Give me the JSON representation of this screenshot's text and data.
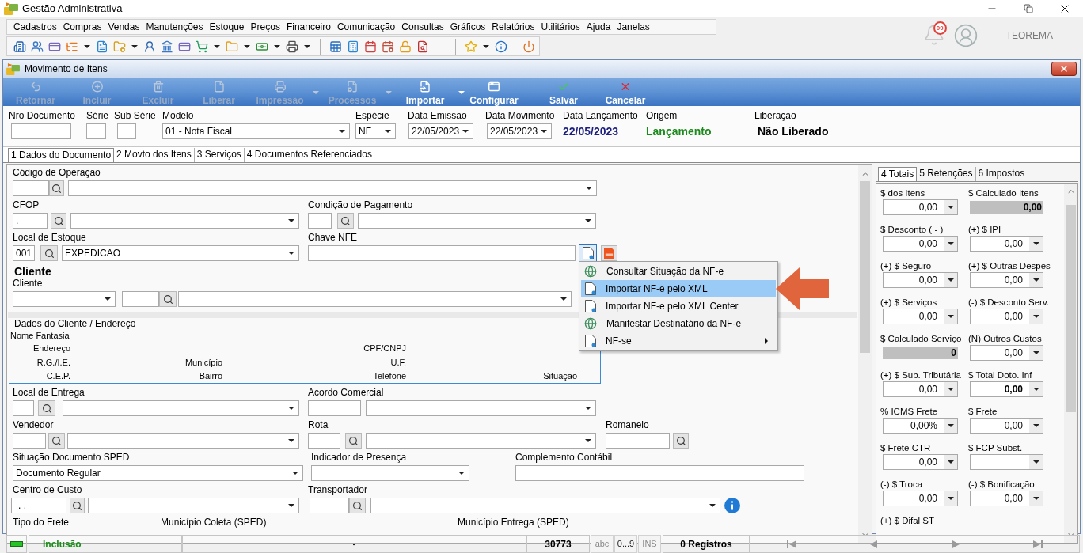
{
  "window": {
    "title": "Gestão Administrativa"
  },
  "menu_bar": [
    "Cadastros",
    "Compras",
    "Vendas",
    "Manutenções",
    "Estoque",
    "Preços",
    "Financeiro",
    "Comunicação",
    "Consultas",
    "Gráficos",
    "Relatórios",
    "Utilitários",
    "Ajuda",
    "Janelas"
  ],
  "notifications": {
    "count": "00"
  },
  "user": {
    "name": "TEOREMA"
  },
  "document_window": {
    "title": "Movimento de Itens"
  },
  "toolbar": [
    {
      "label": "Retornar",
      "disabled": true,
      "dropdown": false
    },
    {
      "label": "Incluir",
      "disabled": true,
      "dropdown": false
    },
    {
      "label": "Excluir",
      "disabled": true,
      "dropdown": false
    },
    {
      "label": "Liberar",
      "disabled": true,
      "dropdown": false
    },
    {
      "label": "Impressão",
      "disabled": true,
      "dropdown": true
    },
    {
      "label": "Processos",
      "disabled": true,
      "dropdown": true
    },
    {
      "label": "Importar",
      "disabled": false,
      "dropdown": true
    },
    {
      "label": "Configurar",
      "disabled": false,
      "dropdown": false
    },
    {
      "label": "Salvar",
      "disabled": false,
      "dropdown": false
    },
    {
      "label": "Cancelar",
      "disabled": false,
      "dropdown": false
    }
  ],
  "header": [
    {
      "label": "Nro Documento",
      "kind": "input"
    },
    {
      "label": "Série",
      "kind": "input"
    },
    {
      "label": "Sub Série",
      "kind": "input"
    },
    {
      "label": "Modelo",
      "kind": "select",
      "value": "01 - Nota Fiscal"
    },
    {
      "label": "Espécie",
      "kind": "select",
      "value": "NF"
    },
    {
      "label": "Data Emissão",
      "kind": "select",
      "value": "22/05/2023"
    },
    {
      "label": "Data Movimento",
      "kind": "select",
      "value": "22/05/2023"
    },
    {
      "label": "Data Lançamento",
      "kind": "display",
      "value": "22/05/2023",
      "color": "#1c1f7e"
    },
    {
      "label": "Origem",
      "kind": "display",
      "value": "Lançamento",
      "color": "#1d8a1d"
    },
    {
      "label": "Liberação",
      "kind": "display",
      "value": "Não Liberado",
      "color": "#000000"
    }
  ],
  "tabs": [
    {
      "label": "1 Dados do Documento",
      "selected": true
    },
    {
      "label": "2 Movto dos Itens",
      "selected": false
    },
    {
      "label": "3 Serviços",
      "selected": false
    },
    {
      "label": "4 Documentos Referenciados",
      "selected": false
    }
  ],
  "form": {
    "operation_code": {
      "label": "Código de Operação"
    },
    "cfop": {
      "label": "CFOP",
      "code": "."
    },
    "payment_terms": {
      "label": "Condição de Pagamento"
    },
    "stock_location": {
      "label": "Local de Estoque",
      "code": "001",
      "value": "EXPEDICAO"
    },
    "nfe_key": {
      "label": "Chave NFE",
      "import_pressed": true
    },
    "client_section": {
      "title": "Cliente"
    },
    "client": {
      "label": "Cliente"
    },
    "client_details": {
      "title": "Dados do Cliente / Endereço",
      "labels": [
        "Nome Fantasia",
        "Endereço",
        "CPF/CNPJ",
        "R.G./I.E.",
        "Município",
        "U.F.",
        "C.E.P.",
        "Bairro",
        "Telefone",
        "Situação"
      ]
    },
    "delivery_location": {
      "label": "Local de Entrega"
    },
    "commercial_agreement": {
      "label": "Acordo Comercial"
    },
    "seller": {
      "label": "Vendedor"
    },
    "route": {
      "label": "Rota"
    },
    "packing_list": {
      "label": "Romaneio"
    },
    "sped_status": {
      "label": "Situação Documento SPED",
      "value": "Documento Regular"
    },
    "presence_indicator": {
      "label": "Indicador de Presença"
    },
    "accounting_note": {
      "label": "Complemento Contábil"
    },
    "cost_center": {
      "label": "Centro de Custo",
      "code": ". ."
    },
    "carrier": {
      "label": "Transportador"
    },
    "freight_type": {
      "label": "Tipo do Frete"
    },
    "pickup_city": {
      "label": "Município Coleta (SPED)"
    },
    "delivery_city": {
      "label": "Município Entrega (SPED)"
    }
  },
  "context_menu": [
    {
      "label": "Consultar Situação da NF-e",
      "kind": "online",
      "selected": false,
      "submenu": false
    },
    {
      "label": "Importar NF-e pelo XML",
      "kind": "file",
      "selected": true,
      "submenu": false
    },
    {
      "label": "Importar NF-e pelo XML Center",
      "kind": "file",
      "selected": false,
      "submenu": false
    },
    {
      "label": "Manifestar Destinatário da NF-e",
      "kind": "online",
      "selected": false,
      "submenu": false
    },
    {
      "label": "NF-se",
      "kind": "file",
      "selected": false,
      "submenu": true
    }
  ],
  "totals_panel": {
    "tabs": [
      {
        "label": "4 Totais",
        "selected": true
      },
      {
        "label": "5 Retenções",
        "selected": false
      },
      {
        "label": "6 Impostos",
        "selected": false
      }
    ],
    "fields": [
      {
        "label": "$ dos Itens",
        "kind": "dropdown",
        "value": "0,00",
        "bold": false
      },
      {
        "label": "$ Calculado Itens",
        "kind": "computed",
        "value": "0,00",
        "bold": true
      },
      {
        "label": "$ Desconto ( - )",
        "kind": "dropdown",
        "value": "0,00",
        "bold": false
      },
      {
        "label": "(+) $ IPI",
        "kind": "dropdown",
        "value": "0,00",
        "bold": false
      },
      {
        "label": "(+) $ Seguro",
        "kind": "dropdown",
        "value": "0,00",
        "bold": false
      },
      {
        "label": "(+) $ Outras Despes",
        "kind": "dropdown",
        "value": "0,00",
        "bold": false
      },
      {
        "label": "(+) $ Serviços",
        "kind": "dropdown",
        "value": "0,00",
        "bold": false
      },
      {
        "label": "(-) $ Desconto Serv.",
        "kind": "dropdown",
        "value": "0,00",
        "bold": false
      },
      {
        "label": "$ Calculado Serviço",
        "kind": "computed",
        "value": "0",
        "bold": true
      },
      {
        "label": "(N) Outros Custos",
        "kind": "dropdown",
        "value": "0,00",
        "bold": false
      },
      {
        "label": "(+) $ Sub. Tributária",
        "kind": "dropdown",
        "value": "0,00",
        "bold": false
      },
      {
        "label": "$ Total Doto. Inf",
        "kind": "dropdown",
        "value": "0,00",
        "bold": true
      },
      {
        "label": "% ICMS Frete",
        "kind": "dropdown",
        "value": "0,00%",
        "bold": false
      },
      {
        "label": "$ Frete",
        "kind": "dropdown",
        "value": "0,00",
        "bold": false
      },
      {
        "label": "$ Frete CTR",
        "kind": "dropdown",
        "value": "0,00",
        "bold": false
      },
      {
        "label": "$ FCP Subst.",
        "kind": "dropdown"
      },
      {
        "label": "(-) $ Troca",
        "kind": "dropdown",
        "value": "0,00",
        "bold": false
      },
      {
        "label": "(-) $ Bonificação",
        "kind": "dropdown",
        "value": "0,00",
        "bold": false
      },
      {
        "label": "(+) $ Difal ST",
        "kind": "label"
      }
    ]
  },
  "status_bar": {
    "mode": "Inclusão",
    "message": "-",
    "code": "30773",
    "indicators": [
      {
        "label": "abc",
        "on": false
      },
      {
        "label": "0...9",
        "on": true
      },
      {
        "label": "INS",
        "on": false
      }
    ],
    "records": "0 Registros"
  }
}
